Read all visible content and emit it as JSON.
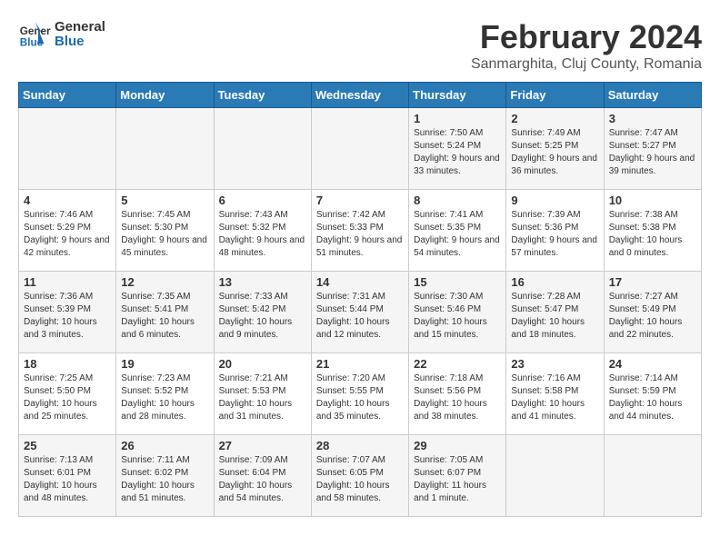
{
  "logo": {
    "text_general": "General",
    "text_blue": "Blue"
  },
  "header": {
    "title": "February 2024",
    "subtitle": "Sanmarghita, Cluj County, Romania"
  },
  "days_of_week": [
    "Sunday",
    "Monday",
    "Tuesday",
    "Wednesday",
    "Thursday",
    "Friday",
    "Saturday"
  ],
  "weeks": [
    [
      {
        "day": "",
        "info": ""
      },
      {
        "day": "",
        "info": ""
      },
      {
        "day": "",
        "info": ""
      },
      {
        "day": "",
        "info": ""
      },
      {
        "day": "1",
        "info": "Sunrise: 7:50 AM\nSunset: 5:24 PM\nDaylight: 9 hours and 33 minutes."
      },
      {
        "day": "2",
        "info": "Sunrise: 7:49 AM\nSunset: 5:25 PM\nDaylight: 9 hours and 36 minutes."
      },
      {
        "day": "3",
        "info": "Sunrise: 7:47 AM\nSunset: 5:27 PM\nDaylight: 9 hours and 39 minutes."
      }
    ],
    [
      {
        "day": "4",
        "info": "Sunrise: 7:46 AM\nSunset: 5:29 PM\nDaylight: 9 hours and 42 minutes."
      },
      {
        "day": "5",
        "info": "Sunrise: 7:45 AM\nSunset: 5:30 PM\nDaylight: 9 hours and 45 minutes."
      },
      {
        "day": "6",
        "info": "Sunrise: 7:43 AM\nSunset: 5:32 PM\nDaylight: 9 hours and 48 minutes."
      },
      {
        "day": "7",
        "info": "Sunrise: 7:42 AM\nSunset: 5:33 PM\nDaylight: 9 hours and 51 minutes."
      },
      {
        "day": "8",
        "info": "Sunrise: 7:41 AM\nSunset: 5:35 PM\nDaylight: 9 hours and 54 minutes."
      },
      {
        "day": "9",
        "info": "Sunrise: 7:39 AM\nSunset: 5:36 PM\nDaylight: 9 hours and 57 minutes."
      },
      {
        "day": "10",
        "info": "Sunrise: 7:38 AM\nSunset: 5:38 PM\nDaylight: 10 hours and 0 minutes."
      }
    ],
    [
      {
        "day": "11",
        "info": "Sunrise: 7:36 AM\nSunset: 5:39 PM\nDaylight: 10 hours and 3 minutes."
      },
      {
        "day": "12",
        "info": "Sunrise: 7:35 AM\nSunset: 5:41 PM\nDaylight: 10 hours and 6 minutes."
      },
      {
        "day": "13",
        "info": "Sunrise: 7:33 AM\nSunset: 5:42 PM\nDaylight: 10 hours and 9 minutes."
      },
      {
        "day": "14",
        "info": "Sunrise: 7:31 AM\nSunset: 5:44 PM\nDaylight: 10 hours and 12 minutes."
      },
      {
        "day": "15",
        "info": "Sunrise: 7:30 AM\nSunset: 5:46 PM\nDaylight: 10 hours and 15 minutes."
      },
      {
        "day": "16",
        "info": "Sunrise: 7:28 AM\nSunset: 5:47 PM\nDaylight: 10 hours and 18 minutes."
      },
      {
        "day": "17",
        "info": "Sunrise: 7:27 AM\nSunset: 5:49 PM\nDaylight: 10 hours and 22 minutes."
      }
    ],
    [
      {
        "day": "18",
        "info": "Sunrise: 7:25 AM\nSunset: 5:50 PM\nDaylight: 10 hours and 25 minutes."
      },
      {
        "day": "19",
        "info": "Sunrise: 7:23 AM\nSunset: 5:52 PM\nDaylight: 10 hours and 28 minutes."
      },
      {
        "day": "20",
        "info": "Sunrise: 7:21 AM\nSunset: 5:53 PM\nDaylight: 10 hours and 31 minutes."
      },
      {
        "day": "21",
        "info": "Sunrise: 7:20 AM\nSunset: 5:55 PM\nDaylight: 10 hours and 35 minutes."
      },
      {
        "day": "22",
        "info": "Sunrise: 7:18 AM\nSunset: 5:56 PM\nDaylight: 10 hours and 38 minutes."
      },
      {
        "day": "23",
        "info": "Sunrise: 7:16 AM\nSunset: 5:58 PM\nDaylight: 10 hours and 41 minutes."
      },
      {
        "day": "24",
        "info": "Sunrise: 7:14 AM\nSunset: 5:59 PM\nDaylight: 10 hours and 44 minutes."
      }
    ],
    [
      {
        "day": "25",
        "info": "Sunrise: 7:13 AM\nSunset: 6:01 PM\nDaylight: 10 hours and 48 minutes."
      },
      {
        "day": "26",
        "info": "Sunrise: 7:11 AM\nSunset: 6:02 PM\nDaylight: 10 hours and 51 minutes."
      },
      {
        "day": "27",
        "info": "Sunrise: 7:09 AM\nSunset: 6:04 PM\nDaylight: 10 hours and 54 minutes."
      },
      {
        "day": "28",
        "info": "Sunrise: 7:07 AM\nSunset: 6:05 PM\nDaylight: 10 hours and 58 minutes."
      },
      {
        "day": "29",
        "info": "Sunrise: 7:05 AM\nSunset: 6:07 PM\nDaylight: 11 hours and 1 minute."
      },
      {
        "day": "",
        "info": ""
      },
      {
        "day": "",
        "info": ""
      }
    ]
  ]
}
